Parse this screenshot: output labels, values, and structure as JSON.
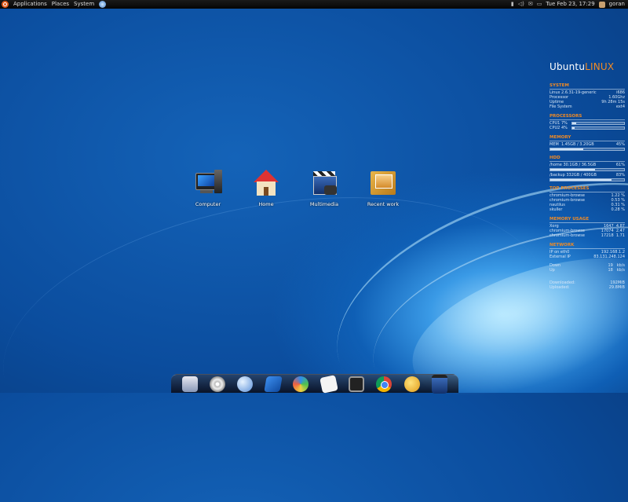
{
  "top_panel": {
    "menus": [
      "Applications",
      "Places",
      "System"
    ],
    "datetime": "Tue Feb 23, 17:29",
    "user": "goran"
  },
  "desktop_icons": [
    {
      "label": "Computer",
      "icon": "computer-icon"
    },
    {
      "label": "Home",
      "icon": "home-folder-icon"
    },
    {
      "label": "Multimedia",
      "icon": "multimedia-icon"
    },
    {
      "label": "Recent work",
      "icon": "recent-work-icon"
    }
  ],
  "conky": {
    "brand_prefix": "Ubuntu",
    "brand_suffix": "LINUX",
    "system": {
      "heading": "SYSTEM",
      "rows": [
        {
          "label": "Linux 2.6.31-19-generic",
          "value": "i686"
        },
        {
          "label": "Processor",
          "value": "1.60Ghz"
        },
        {
          "label": "Uptime",
          "value": "9h 28m 15s"
        },
        {
          "label": "File System",
          "value": "ext4"
        }
      ]
    },
    "processors": {
      "heading": "PROCESSORS",
      "cpus": [
        {
          "label": "CPU1",
          "value": "7%",
          "level": 0.07
        },
        {
          "label": "CPU2",
          "value": "4%",
          "level": 0.04
        }
      ]
    },
    "memory": {
      "heading": "MEMORY",
      "label": "MEM",
      "used": "1.45GB / 3.20GB",
      "percent": "45%",
      "level": 0.45
    },
    "hdd": {
      "heading": "HDD",
      "disks": [
        {
          "label": "/home",
          "used": "30.1GB / 36.5GB",
          "percent": "61%",
          "level": 0.61
        },
        {
          "label": "/backup",
          "used": "332GB / 400GB",
          "percent": "83%",
          "level": 0.83
        }
      ]
    },
    "top_processes": {
      "heading": "TOP PROCESSES",
      "rows": [
        {
          "name": "chromium-browse",
          "value": "1.22 %"
        },
        {
          "name": "chromium-browse",
          "value": "0.53 %"
        },
        {
          "name": "nautilus",
          "value": "0.31 %"
        },
        {
          "name": "skuller",
          "value": "0.28 %"
        }
      ]
    },
    "memory_usage": {
      "heading": "MEMORY USAGE",
      "rows": [
        {
          "name": "Xorg",
          "pid": "1647",
          "value": "4.87"
        },
        {
          "name": "chromium-browse",
          "pid": "17074",
          "value": "2.47"
        },
        {
          "name": "chromium-browse",
          "pid": "17218",
          "value": "1.71"
        }
      ]
    },
    "network": {
      "heading": "NETWORK",
      "ip_label": "IP on eth0",
      "ip_value": "192.168.1.2",
      "ext_label": "External IP",
      "ext_value": "83.131.248.124",
      "down_label": "Down",
      "down_value": "19",
      "down_unit": "kb/s",
      "up_label": "Up",
      "up_value": "18",
      "up_unit": "kb/s",
      "downloaded_label": "Downloaded:",
      "downloaded_value": "192MiB",
      "uploaded_label": "Uploaded:",
      "uploaded_value": "29.8MiB"
    }
  },
  "dock": {
    "items": [
      "finder-icon",
      "dvd-player-icon",
      "network-globe-icon",
      "dictionary-book-icon",
      "photo-ball-icon",
      "text-editor-icon",
      "system-monitor-icon",
      "chrome-icon",
      "mail-client-icon",
      "movie-player-icon"
    ]
  },
  "colors": {
    "accent": "#f08a24",
    "panel": "#0a0a0a",
    "desktop": "#0b4d9e"
  }
}
